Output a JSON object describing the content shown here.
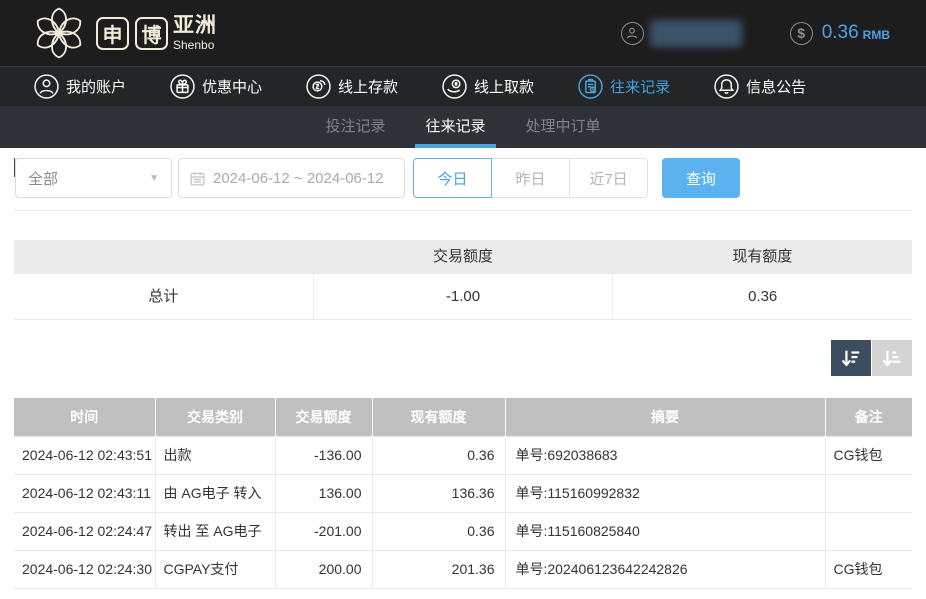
{
  "brand": {
    "char1": "申",
    "char2": "博",
    "region": "亚洲",
    "latin": "Shenbo"
  },
  "account": {
    "balance": "0.36",
    "currency": "RMB",
    "currency_symbol": "$"
  },
  "nav": {
    "items": [
      {
        "label": "我的账户",
        "icon": "user-icon",
        "active": false
      },
      {
        "label": "优惠中心",
        "icon": "gift-icon",
        "active": false
      },
      {
        "label": "线上存款",
        "icon": "deposit-icon",
        "active": false
      },
      {
        "label": "线上取款",
        "icon": "withdraw-icon",
        "active": false
      },
      {
        "label": "往来记录",
        "icon": "records-icon",
        "active": true
      },
      {
        "label": "信息公告",
        "icon": "bell-icon",
        "active": false
      }
    ]
  },
  "subnav": {
    "tabs": [
      {
        "label": "投注记录",
        "active": false
      },
      {
        "label": "往来记录",
        "active": true
      },
      {
        "label": "处理中订单",
        "active": false
      }
    ]
  },
  "filters": {
    "type_filter_value": "全部",
    "date_range_value": "2024-06-12 ~ 2024-06-12",
    "quick": [
      {
        "label": "今日",
        "active": true
      },
      {
        "label": "昨日",
        "active": false
      },
      {
        "label": "近7日",
        "active": false
      }
    ],
    "search_label": "查询"
  },
  "summary": {
    "header": [
      "",
      "交易额度",
      "现有额度"
    ],
    "row_label": "总计",
    "transaction_total": "-1.00",
    "balance_total": "0.36"
  },
  "records": {
    "columns": [
      "时间",
      "交易类别",
      "交易额度",
      "现有额度",
      "摘要",
      "备注"
    ],
    "rows": [
      [
        "2024-06-12 02:43:51",
        "出款",
        "-136.00",
        "0.36",
        "单号:692038683",
        "CG钱包"
      ],
      [
        "2024-06-12 02:43:11",
        "由 AG电子 转入",
        "136.00",
        "136.36",
        "单号:115160992832",
        ""
      ],
      [
        "2024-06-12 02:24:47",
        "转出 至 AG电子",
        "-201.00",
        "0.36",
        "单号:115160825840",
        ""
      ],
      [
        "2024-06-12 02:24:30",
        "CGPAY支付",
        "200.00",
        "201.36",
        "单号:202406123642242826",
        "CG钱包"
      ]
    ]
  },
  "colors": {
    "accent_blue": "#4aa4e0",
    "search_button_blue": "#5bb2ee",
    "topbar_dark": "#1e1d1d",
    "navbar_dark": "#232526",
    "subnav_dark": "#2e3236",
    "table_header_gray": "#c0c0c0",
    "sort_active_bg": "#3d4d60",
    "brand_cream": "#f1ecd9"
  }
}
